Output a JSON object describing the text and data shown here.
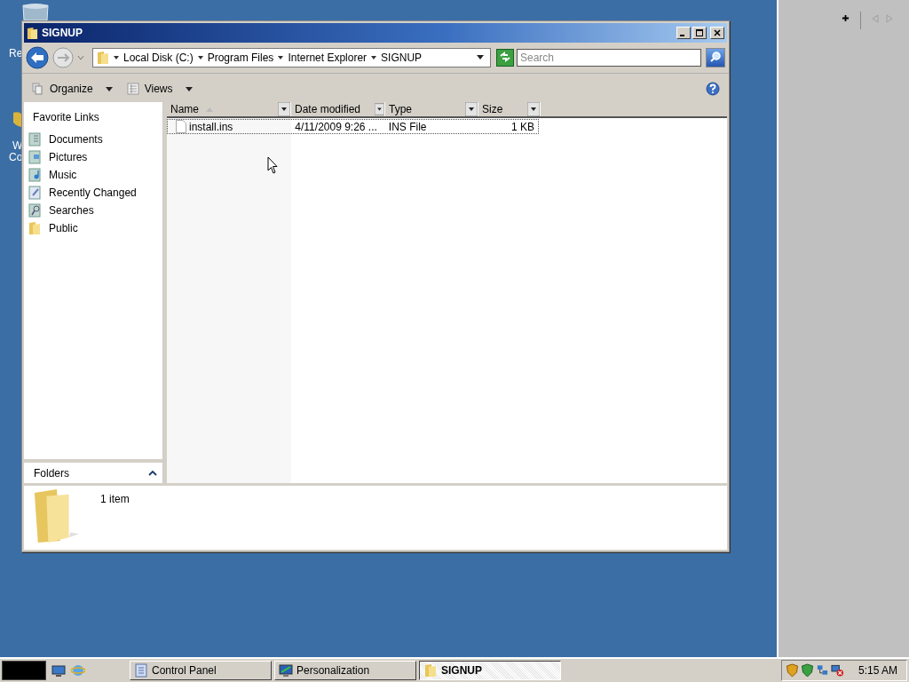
{
  "desktop_icons": [
    {
      "lines": [
        "Re"
      ]
    },
    {
      "lines": [
        "W",
        "Co"
      ]
    }
  ],
  "window": {
    "title": "SIGNUP"
  },
  "address_bar": {
    "path": [
      "Local Disk (C:)",
      "Program Files",
      "Internet Explorer",
      "SIGNUP"
    ]
  },
  "search": {
    "placeholder": "Search"
  },
  "toolbar": [
    {
      "label": "Organize"
    },
    {
      "label": "Views"
    }
  ],
  "favorite_links": {
    "title": "Favorite Links",
    "items": [
      {
        "label": "Documents",
        "kind": "documents"
      },
      {
        "label": "Pictures",
        "kind": "pictures"
      },
      {
        "label": "Music",
        "kind": "music"
      },
      {
        "label": "Recently Changed",
        "kind": "recent"
      },
      {
        "label": "Searches",
        "kind": "searches"
      },
      {
        "label": "Public",
        "kind": "folder"
      }
    ]
  },
  "folders_pane": {
    "label": "Folders",
    "expanded": false
  },
  "file_list": {
    "columns": [
      {
        "label": "Name",
        "sorted": true
      },
      {
        "label": "Date modified",
        "sorted": false
      },
      {
        "label": "Type",
        "sorted": false
      },
      {
        "label": "Size",
        "sorted": false
      }
    ],
    "rows": [
      {
        "name": "install.ins",
        "date": "4/11/2009 9:26 ...",
        "type": "INS File",
        "size": "1 KB",
        "focused": true
      }
    ]
  },
  "details_pane": {
    "text": "1 item"
  },
  "taskbar": {
    "tasks": [
      {
        "label": "Control Panel",
        "kind": "control",
        "selected": false
      },
      {
        "label": "Personalization",
        "kind": "personalization",
        "selected": false
      },
      {
        "label": "SIGNUP",
        "kind": "folder",
        "selected": true
      }
    ],
    "clock": "5:15 AM"
  }
}
